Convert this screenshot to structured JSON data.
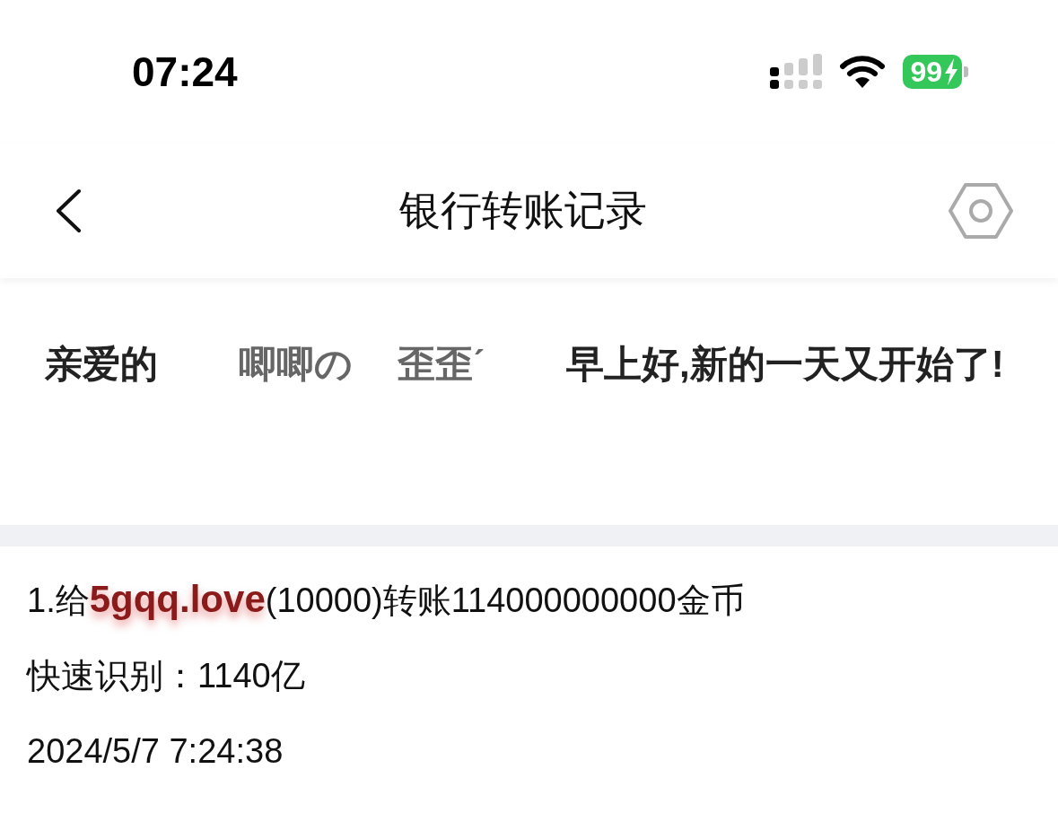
{
  "status_bar": {
    "time": "07:24",
    "battery": "99",
    "charging": true
  },
  "header": {
    "title": "银行转账记录"
  },
  "greeting": {
    "parts": [
      {
        "kind": "text",
        "text": "亲爱的"
      },
      {
        "kind": "name",
        "text": "唧唧の"
      },
      {
        "kind": "name",
        "text": "歪歪ˊ"
      },
      {
        "kind": "text",
        "text": "早上好,新的一天又开始了!"
      }
    ]
  },
  "records": [
    {
      "line": "1.给**5gqq.love**(10000)转账114000000000金币",
      "quick": "快速识别：1140亿",
      "time": "2024/5/7 7:24:38"
    }
  ]
}
